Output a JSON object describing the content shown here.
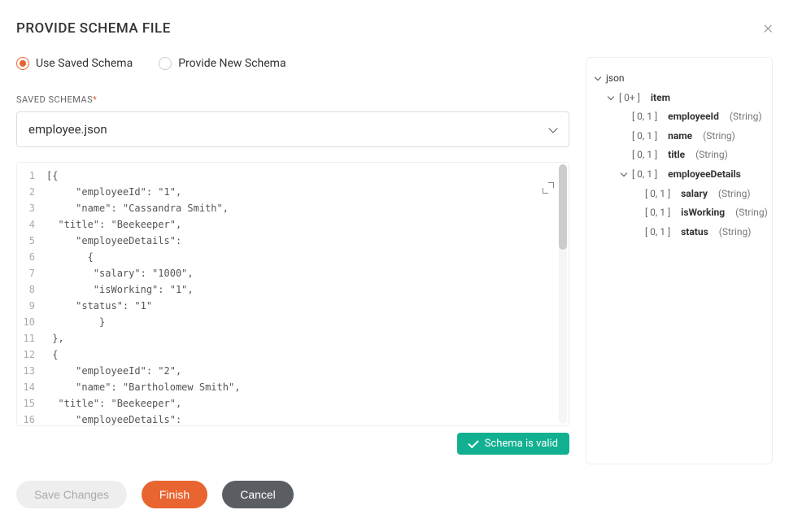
{
  "header": {
    "title": "PROVIDE SCHEMA FILE"
  },
  "radios": {
    "use_saved": "Use Saved Schema",
    "provide_new": "Provide New Schema"
  },
  "saved_schemas": {
    "label": "SAVED SCHEMAS",
    "value": "employee.json"
  },
  "editor": {
    "line_count": 16,
    "lines": [
      "[{",
      "     \"employeeId\": \"1\",",
      "     \"name\": \"Cassandra Smith\",",
      "  \"title\": \"Beekeeper\",",
      "     \"employeeDetails\":",
      "       {",
      "        \"salary\": \"1000\",",
      "        \"isWorking\": \"1\",",
      "     \"status\": \"1\"",
      "         }",
      " },",
      " {",
      "     \"employeeId\": \"2\",",
      "     \"name\": \"Bartholomew Smith\",",
      "  \"title\": \"Beekeeper\",",
      "     \"employeeDetails\":"
    ]
  },
  "validation": {
    "message": "Schema is valid"
  },
  "buttons": {
    "save": "Save Changes",
    "finish": "Finish",
    "cancel": "Cancel"
  },
  "tree": {
    "root": "json",
    "item_card": "[ 0+ ]",
    "item": "item",
    "c01": "[ 0, 1 ]",
    "fields": {
      "employeeId": {
        "name": "employeeId",
        "type": "(String)"
      },
      "name": {
        "name": "name",
        "type": "(String)"
      },
      "title": {
        "name": "title",
        "type": "(String)"
      },
      "employeeDetails": {
        "name": "employeeDetails"
      },
      "salary": {
        "name": "salary",
        "type": "(String)"
      },
      "isWorking": {
        "name": "isWorking",
        "type": "(String)"
      },
      "status": {
        "name": "status",
        "type": "(String)"
      }
    }
  }
}
